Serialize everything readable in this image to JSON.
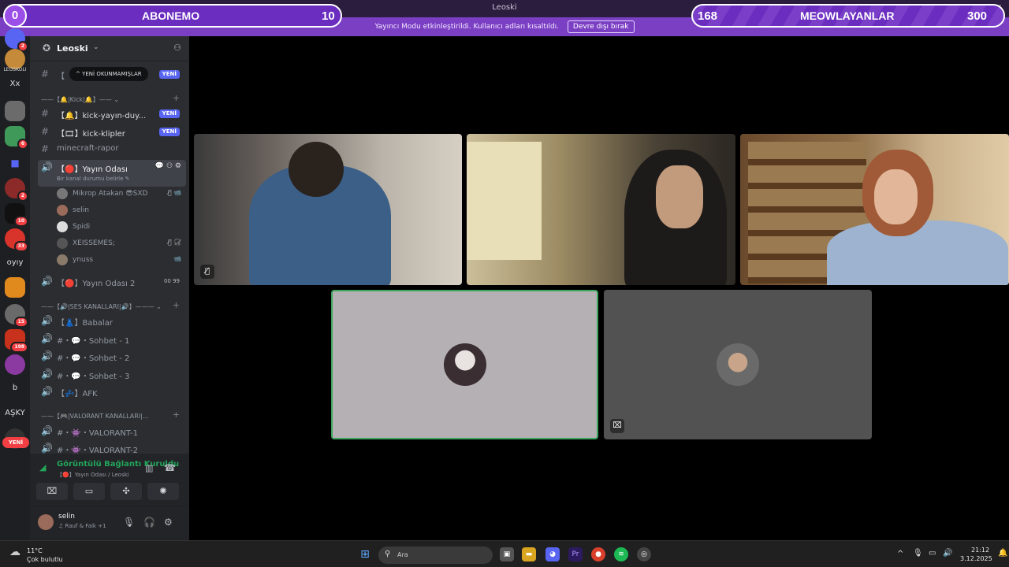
{
  "window": {
    "title": "Leoski",
    "controls": [
      "—",
      "☐",
      "✕"
    ]
  },
  "notice": {
    "text": "Yayıncı Modu etkinleştirildi. Kullanıcı adları kısaltıldı.",
    "button": "Devre dışı bırak"
  },
  "overlays": {
    "left": {
      "start": "0",
      "title": "ABONEMO",
      "value": "10"
    },
    "right": {
      "start": "168",
      "title": "MEOWLAYANLAR",
      "value": "300"
    }
  },
  "server_rail": {
    "labels": [
      "LEOSKOLI",
      "Xx",
      "oyıy",
      "b",
      "AŞKY"
    ],
    "badges": [
      "2",
      "6",
      "2",
      "10",
      "33",
      "15",
      "198"
    ],
    "new_label": "YENİ"
  },
  "sidebar": {
    "server_name": "Leoski",
    "unread_tip": "^ YENİ OKUNMAMIŞLAR",
    "channels": [
      {
        "name": "【 ",
        "new": "YENİ"
      },
      {
        "name": "【🔔】kick-yayın-duy...",
        "new": "YENİ"
      },
      {
        "name": "【🎞】kick-klipler",
        "new": "YENİ"
      },
      {
        "name": "minecraft-rapor"
      }
    ],
    "categories": {
      "kick": "——【🔔|Kick|🔔】—— ⌄",
      "ses": "——【🔊|SES KANALLARI|🔊】——— ⌄",
      "valorant": "——【🎮|VALORANT KANALLARI|..."
    },
    "active_channel": {
      "name": "【🔴】Yayın Odası",
      "topic": "Bir kanal durumu belirle ✎"
    },
    "members": [
      {
        "name": "Mikrop Atakan 😎SXD",
        "icons": "🎙̸ 📹"
      },
      {
        "name": "selin",
        "icons": ""
      },
      {
        "name": "Spidi",
        "icons": ""
      },
      {
        "name": "XEISSEMES;",
        "icons": "🎙̸ 🎧̸"
      },
      {
        "name": "ynuss",
        "icons": "📹"
      }
    ],
    "voice_channels": [
      {
        "name": "【🔴】Yayın Odası 2",
        "extra": "00 99"
      },
      {
        "name": "【👗】Babalar"
      },
      {
        "name": "#・💬・Sohbet - 1"
      },
      {
        "name": "#・💬・Sohbet - 2"
      },
      {
        "name": "#・💬・Sohbet - 3"
      },
      {
        "name": "【💤】AFK"
      },
      {
        "name": "#・👾・VALORANT-1"
      },
      {
        "name": "#・👾・VALORANT-2"
      }
    ],
    "voice_panel": {
      "status": "Görüntülü Bağlantı Kuruldu",
      "sub": "【🔴】Yayın Odası / Leoski"
    },
    "user": {
      "name": "selin",
      "status": "♫ Rauf & Faik +1"
    }
  },
  "taskbar": {
    "weather_temp": "11°C",
    "weather_desc": "Çok bulutlu",
    "search_placeholder": "Ara",
    "time": "21:12",
    "date": "3.12.2025"
  },
  "colors": {
    "accent": "#7b3fc4",
    "discord_dark": "#1e1f22",
    "sidebar": "#2b2d31",
    "connected": "#23a55a",
    "speaking_border": "#3ba55d"
  }
}
